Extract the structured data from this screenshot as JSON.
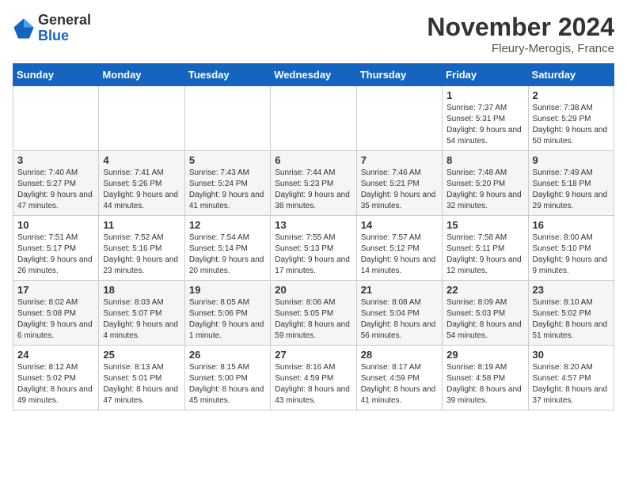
{
  "header": {
    "logo": {
      "line1": "General",
      "line2": "Blue"
    },
    "title": "November 2024",
    "location": "Fleury-Merogis, France"
  },
  "calendar": {
    "days_of_week": [
      "Sunday",
      "Monday",
      "Tuesday",
      "Wednesday",
      "Thursday",
      "Friday",
      "Saturday"
    ],
    "weeks": [
      [
        {
          "day": "",
          "info": ""
        },
        {
          "day": "",
          "info": ""
        },
        {
          "day": "",
          "info": ""
        },
        {
          "day": "",
          "info": ""
        },
        {
          "day": "",
          "info": ""
        },
        {
          "day": "1",
          "info": "Sunrise: 7:37 AM\nSunset: 5:31 PM\nDaylight: 9 hours and 54 minutes."
        },
        {
          "day": "2",
          "info": "Sunrise: 7:38 AM\nSunset: 5:29 PM\nDaylight: 9 hours and 50 minutes."
        }
      ],
      [
        {
          "day": "3",
          "info": "Sunrise: 7:40 AM\nSunset: 5:27 PM\nDaylight: 9 hours and 47 minutes."
        },
        {
          "day": "4",
          "info": "Sunrise: 7:41 AM\nSunset: 5:26 PM\nDaylight: 9 hours and 44 minutes."
        },
        {
          "day": "5",
          "info": "Sunrise: 7:43 AM\nSunset: 5:24 PM\nDaylight: 9 hours and 41 minutes."
        },
        {
          "day": "6",
          "info": "Sunrise: 7:44 AM\nSunset: 5:23 PM\nDaylight: 9 hours and 38 minutes."
        },
        {
          "day": "7",
          "info": "Sunrise: 7:46 AM\nSunset: 5:21 PM\nDaylight: 9 hours and 35 minutes."
        },
        {
          "day": "8",
          "info": "Sunrise: 7:48 AM\nSunset: 5:20 PM\nDaylight: 9 hours and 32 minutes."
        },
        {
          "day": "9",
          "info": "Sunrise: 7:49 AM\nSunset: 5:18 PM\nDaylight: 9 hours and 29 minutes."
        }
      ],
      [
        {
          "day": "10",
          "info": "Sunrise: 7:51 AM\nSunset: 5:17 PM\nDaylight: 9 hours and 26 minutes."
        },
        {
          "day": "11",
          "info": "Sunrise: 7:52 AM\nSunset: 5:16 PM\nDaylight: 9 hours and 23 minutes."
        },
        {
          "day": "12",
          "info": "Sunrise: 7:54 AM\nSunset: 5:14 PM\nDaylight: 9 hours and 20 minutes."
        },
        {
          "day": "13",
          "info": "Sunrise: 7:55 AM\nSunset: 5:13 PM\nDaylight: 9 hours and 17 minutes."
        },
        {
          "day": "14",
          "info": "Sunrise: 7:57 AM\nSunset: 5:12 PM\nDaylight: 9 hours and 14 minutes."
        },
        {
          "day": "15",
          "info": "Sunrise: 7:58 AM\nSunset: 5:11 PM\nDaylight: 9 hours and 12 minutes."
        },
        {
          "day": "16",
          "info": "Sunrise: 8:00 AM\nSunset: 5:10 PM\nDaylight: 9 hours and 9 minutes."
        }
      ],
      [
        {
          "day": "17",
          "info": "Sunrise: 8:02 AM\nSunset: 5:08 PM\nDaylight: 9 hours and 6 minutes."
        },
        {
          "day": "18",
          "info": "Sunrise: 8:03 AM\nSunset: 5:07 PM\nDaylight: 9 hours and 4 minutes."
        },
        {
          "day": "19",
          "info": "Sunrise: 8:05 AM\nSunset: 5:06 PM\nDaylight: 9 hours and 1 minute."
        },
        {
          "day": "20",
          "info": "Sunrise: 8:06 AM\nSunset: 5:05 PM\nDaylight: 8 hours and 59 minutes."
        },
        {
          "day": "21",
          "info": "Sunrise: 8:08 AM\nSunset: 5:04 PM\nDaylight: 8 hours and 56 minutes."
        },
        {
          "day": "22",
          "info": "Sunrise: 8:09 AM\nSunset: 5:03 PM\nDaylight: 8 hours and 54 minutes."
        },
        {
          "day": "23",
          "info": "Sunrise: 8:10 AM\nSunset: 5:02 PM\nDaylight: 8 hours and 51 minutes."
        }
      ],
      [
        {
          "day": "24",
          "info": "Sunrise: 8:12 AM\nSunset: 5:02 PM\nDaylight: 8 hours and 49 minutes."
        },
        {
          "day": "25",
          "info": "Sunrise: 8:13 AM\nSunset: 5:01 PM\nDaylight: 8 hours and 47 minutes."
        },
        {
          "day": "26",
          "info": "Sunrise: 8:15 AM\nSunset: 5:00 PM\nDaylight: 8 hours and 45 minutes."
        },
        {
          "day": "27",
          "info": "Sunrise: 8:16 AM\nSunset: 4:59 PM\nDaylight: 8 hours and 43 minutes."
        },
        {
          "day": "28",
          "info": "Sunrise: 8:17 AM\nSunset: 4:59 PM\nDaylight: 8 hours and 41 minutes."
        },
        {
          "day": "29",
          "info": "Sunrise: 8:19 AM\nSunset: 4:58 PM\nDaylight: 8 hours and 39 minutes."
        },
        {
          "day": "30",
          "info": "Sunrise: 8:20 AM\nSunset: 4:57 PM\nDaylight: 8 hours and 37 minutes."
        }
      ]
    ]
  }
}
